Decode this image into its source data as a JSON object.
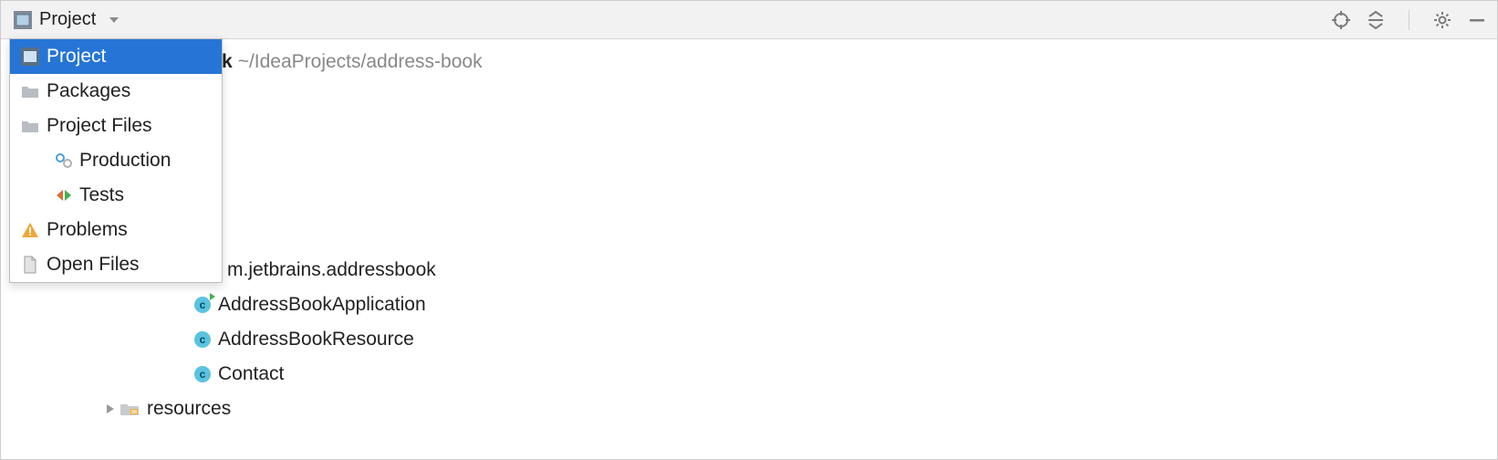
{
  "toolbar": {
    "view_label": "Project"
  },
  "dropdown": {
    "items": [
      {
        "label": "Project",
        "icon": "project-view-icon",
        "selected": true,
        "indent": false
      },
      {
        "label": "Packages",
        "icon": "folder-icon",
        "selected": false,
        "indent": false
      },
      {
        "label": "Project Files",
        "icon": "folder-icon",
        "selected": false,
        "indent": false
      },
      {
        "label": "Production",
        "icon": "gear-folder-icon",
        "selected": false,
        "indent": true
      },
      {
        "label": "Tests",
        "icon": "test-icon",
        "selected": false,
        "indent": true
      },
      {
        "label": "Problems",
        "icon": "warning-icon",
        "selected": false,
        "indent": false
      },
      {
        "label": "Open Files",
        "icon": "file-icon",
        "selected": false,
        "indent": false
      }
    ]
  },
  "tree": {
    "root": {
      "label": "k",
      "path": "~/IdeaProjects/address-book"
    },
    "package_fragment": "m.jetbrains.addressbook",
    "classes": [
      {
        "label": "AddressBookApplication",
        "runnable": true
      },
      {
        "label": "AddressBookResource",
        "runnable": false
      },
      {
        "label": "Contact",
        "runnable": false
      }
    ],
    "resources_label": "resources"
  }
}
